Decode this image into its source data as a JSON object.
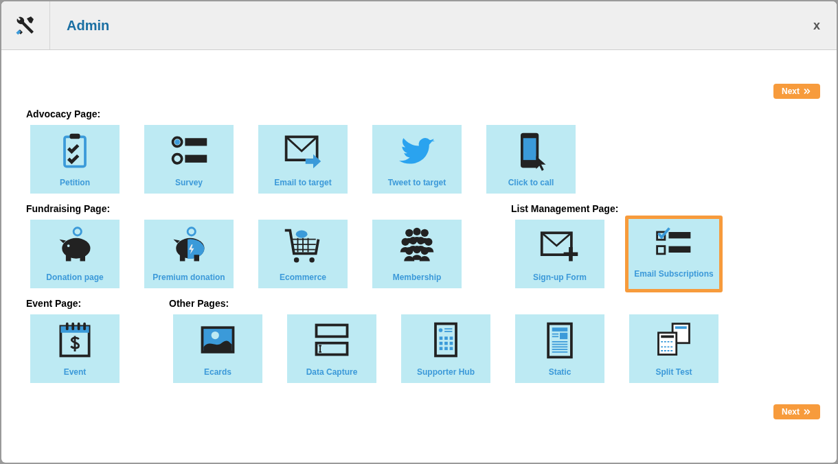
{
  "window": {
    "title": "Admin",
    "close": "x"
  },
  "next_top": "Next",
  "rows": [
    {
      "sections": [
        {
          "heading": "Advocacy Page:",
          "tiles": [
            {
              "label": "Petition",
              "kind": "petition",
              "selected": false
            },
            {
              "label": "Survey",
              "kind": "survey",
              "selected": false
            },
            {
              "label": "Email to target",
              "kind": "email_target",
              "selected": false
            },
            {
              "label": "Tweet to target",
              "kind": "tweet",
              "selected": false
            },
            {
              "label": "Click to call",
              "kind": "phone",
              "selected": false
            }
          ]
        }
      ]
    },
    {
      "sections": [
        {
          "heading": "Fundraising Page:",
          "tiles": [
            {
              "label": "Donation page",
              "kind": "piggy",
              "selected": false
            },
            {
              "label": "Premium donation",
              "kind": "piggy_premium",
              "selected": false
            },
            {
              "label": "Ecommerce",
              "kind": "cart",
              "selected": false
            },
            {
              "label": "Membership",
              "kind": "group",
              "selected": false
            }
          ]
        },
        {
          "heading": "List Management Page:",
          "tiles": [
            {
              "label": "Sign-up Form",
              "kind": "signup",
              "selected": false
            },
            {
              "label": "Email Subscriptions",
              "kind": "checklist",
              "selected": true
            }
          ]
        }
      ]
    },
    {
      "sections": [
        {
          "heading": "Event Page:",
          "tiles": [
            {
              "label": "Event",
              "kind": "event",
              "selected": false
            }
          ]
        },
        {
          "heading": "Other Pages:",
          "tiles": [
            {
              "label": "Ecards",
              "kind": "ecard",
              "selected": false
            },
            {
              "label": "Data Capture",
              "kind": "data",
              "selected": false
            },
            {
              "label": "Supporter Hub",
              "kind": "hub",
              "selected": false
            },
            {
              "label": "Static",
              "kind": "static",
              "selected": false
            },
            {
              "label": "Split Test",
              "kind": "split",
              "selected": false
            }
          ]
        }
      ]
    }
  ],
  "next_bottom": "Next"
}
